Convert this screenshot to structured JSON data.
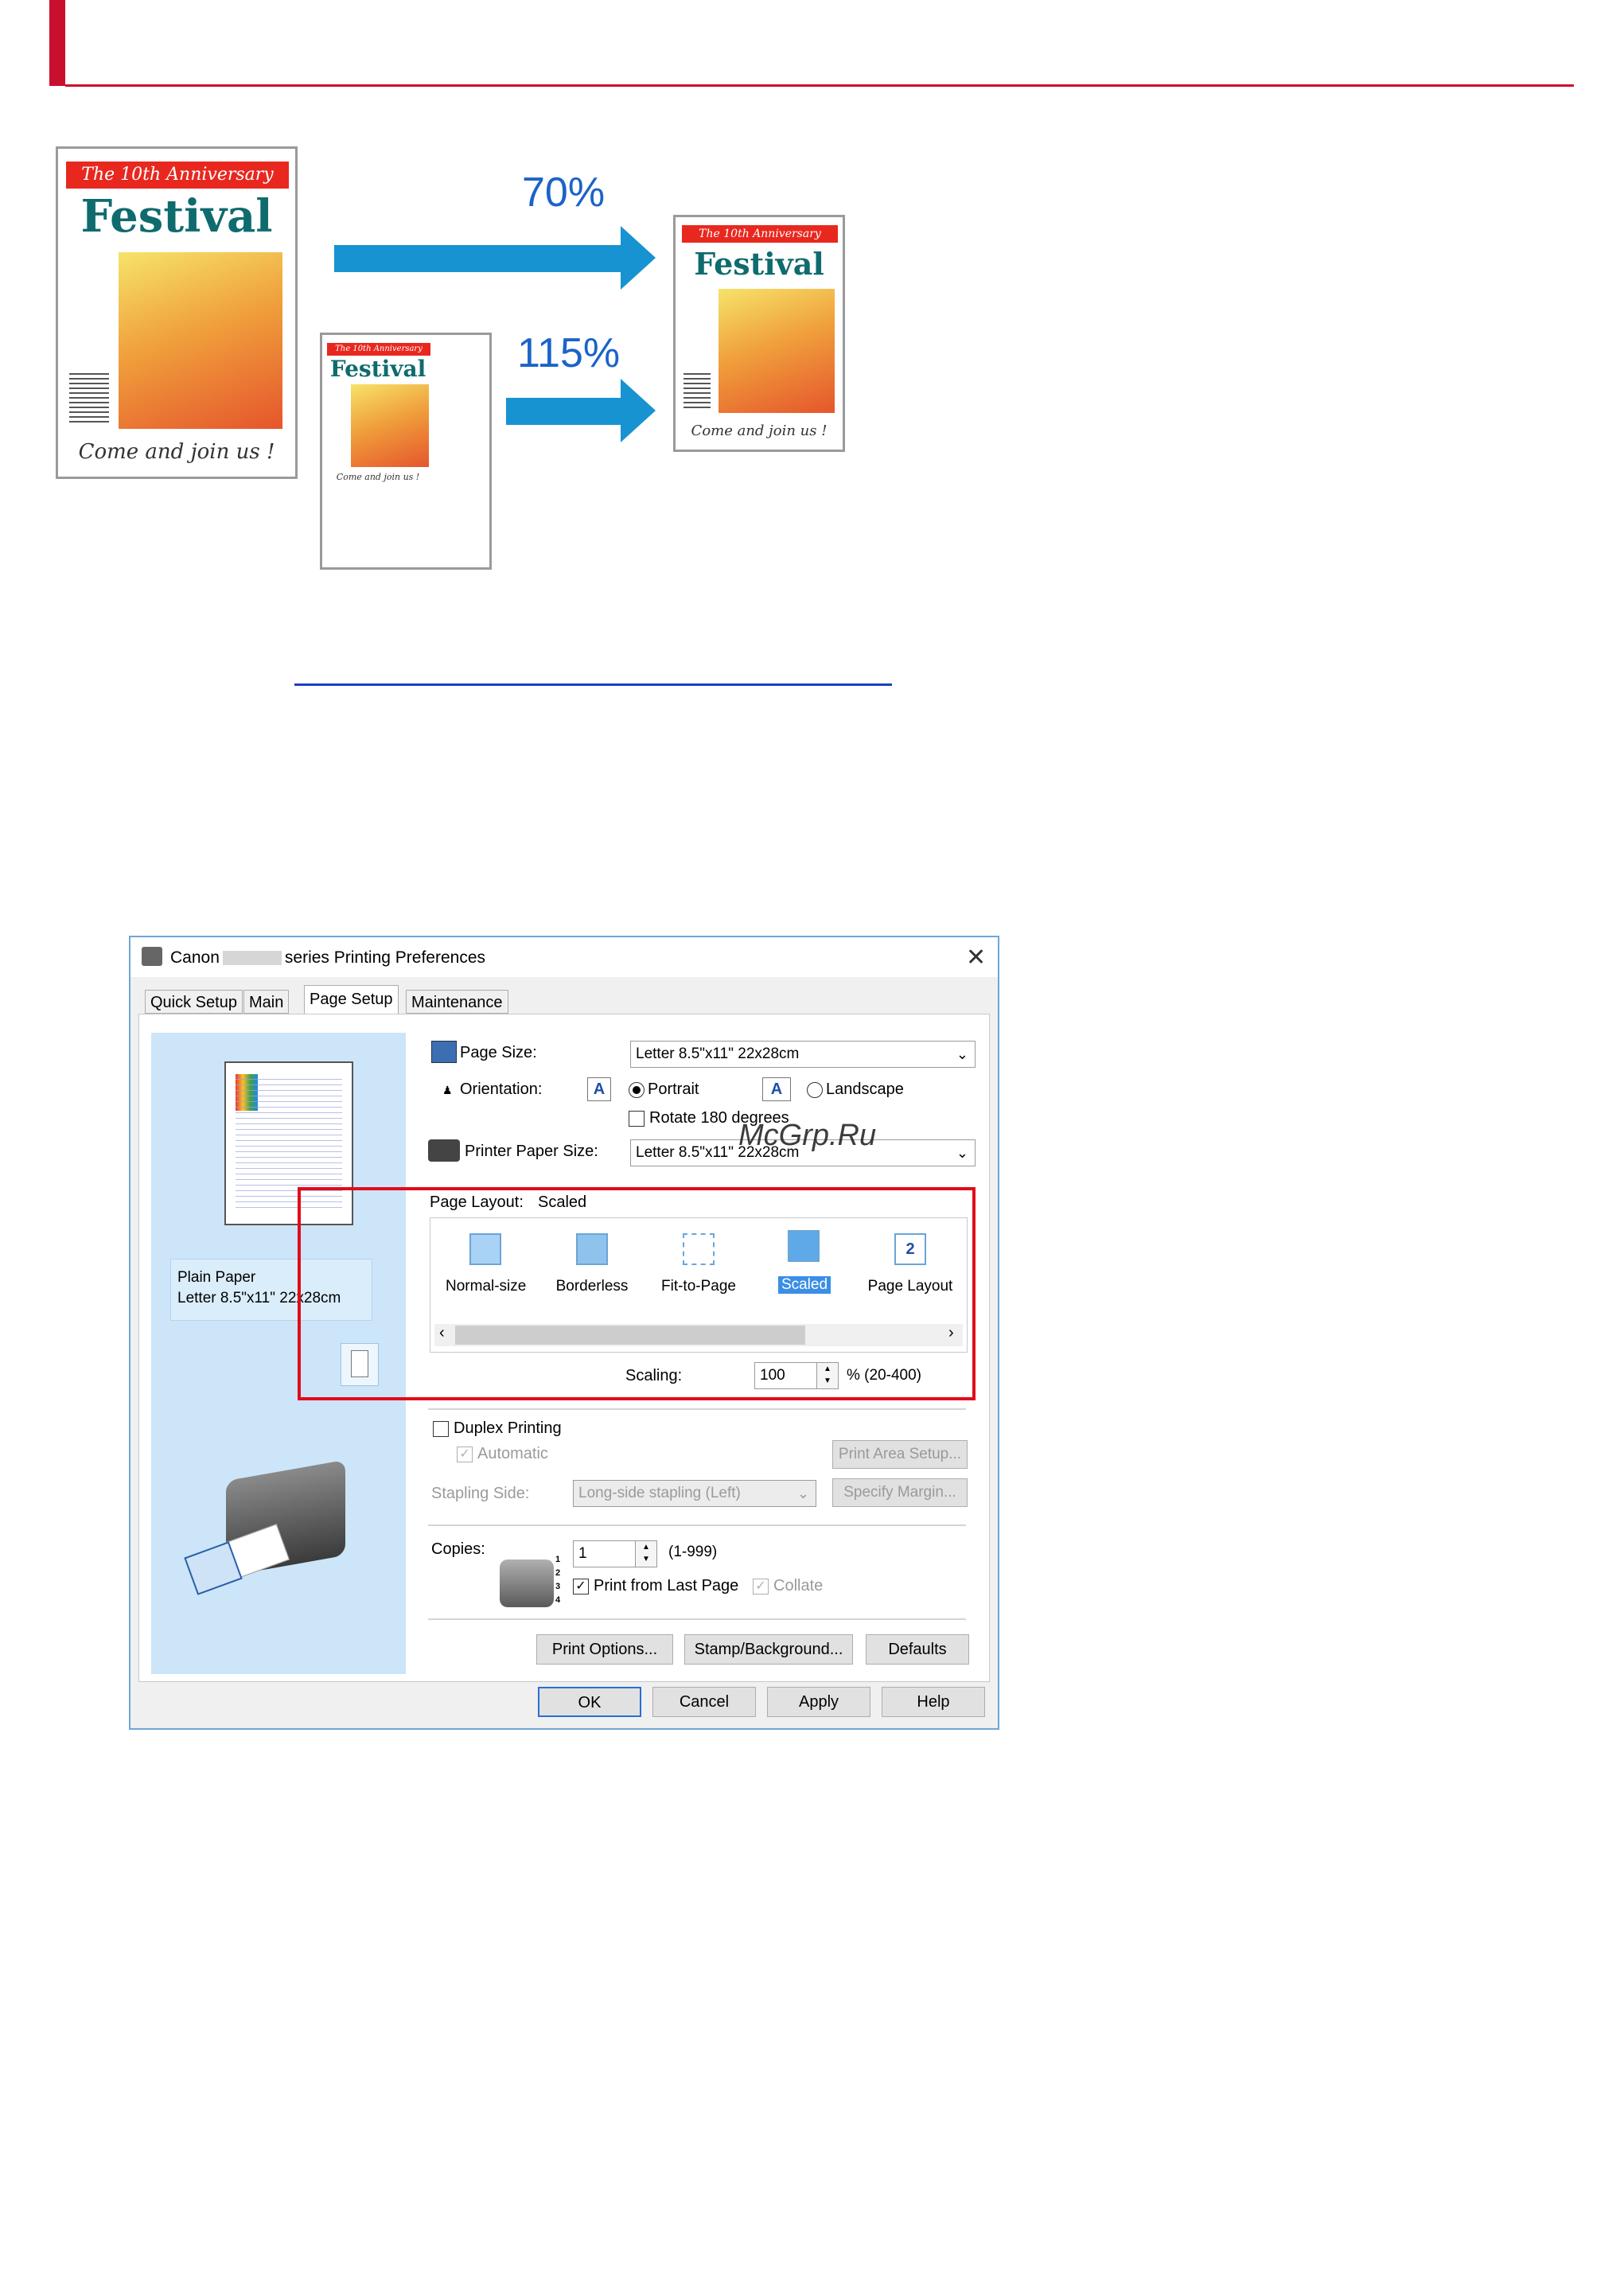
{
  "illustration": {
    "poster_banner": "The 10th Anniversary",
    "poster_title": "Festival",
    "poster_footer": "Come and join us !",
    "arrow_top_label": "70%",
    "arrow_bottom_label": "115%"
  },
  "dialog": {
    "title_prefix": "Canon",
    "title_suffix": "series Printing Preferences",
    "tabs": [
      "Quick Setup",
      "Main",
      "Page Setup",
      "Maintenance"
    ],
    "active_tab": "Page Setup",
    "preview": {
      "media_type": "Plain Paper",
      "media_size": "Letter 8.5\"x11\" 22x28cm"
    },
    "page_size_label": "Page Size:",
    "page_size_value": "Letter 8.5\"x11\" 22x28cm",
    "orientation_label": "Orientation:",
    "portrait_label": "Portrait",
    "landscape_label": "Landscape",
    "orientation_selected": "Portrait",
    "rotate_label": "Rotate 180 degrees",
    "printer_paper_size_label": "Printer Paper Size:",
    "printer_paper_size_value": "Letter 8.5\"x11\" 22x28cm",
    "page_layout_label": "Page Layout:",
    "page_layout_value": "Scaled",
    "layouts": [
      "Normal-size",
      "Borderless",
      "Fit-to-Page",
      "Scaled",
      "Page Layout"
    ],
    "selected_layout": "Scaled",
    "scaling_label": "Scaling:",
    "scaling_value": "100",
    "scaling_range": "% (20-400)",
    "duplex_label": "Duplex Printing",
    "automatic_label": "Automatic",
    "print_area_setup_button": "Print Area Setup...",
    "stapling_side_label": "Stapling Side:",
    "stapling_side_value": "Long-side stapling (Left)",
    "specify_margin_button": "Specify Margin...",
    "copies_label": "Copies:",
    "copies_value": "1",
    "copies_range": "(1-999)",
    "print_from_last_page_label": "Print from Last Page",
    "collate_label": "Collate",
    "print_options_button": "Print Options...",
    "stamp_background_button": "Stamp/Background...",
    "defaults_button": "Defaults",
    "ok_button": "OK",
    "cancel_button": "Cancel",
    "apply_button": "Apply",
    "help_button": "Help"
  },
  "watermark": "McGrp.Ru",
  "colors": {
    "header_red": "#c8102e",
    "arrow_blue": "#1793d1",
    "highlight_red": "#e00c1a",
    "selection_blue": "#3a8ee6"
  }
}
